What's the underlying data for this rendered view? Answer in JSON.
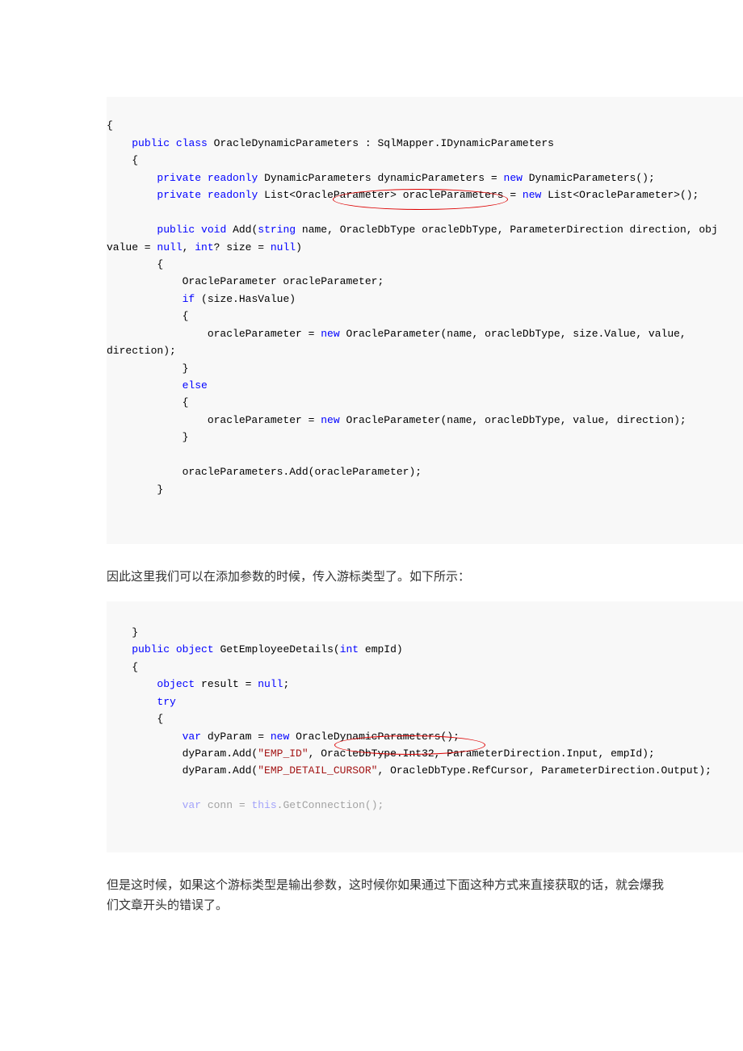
{
  "codeBlock1": {
    "line1": "{",
    "line2_indent": "    ",
    "line2_kw1": "public",
    "line2_sp1": " ",
    "line2_kw2": "class",
    "line2_txt": " OracleDynamicParameters : SqlMapper.IDynamicParameters",
    "line3": "    {",
    "line4_indent": "        ",
    "line4_kw1": "private",
    "line4_sp1": " ",
    "line4_kw2": "readonly",
    "line4_mid": " DynamicParameters dynamicParameters = ",
    "line4_kw3": "new",
    "line4_end": " DynamicParameters();",
    "line5_indent": "        ",
    "line5_kw1": "private",
    "line5_sp1": " ",
    "line5_kw2": "readonly",
    "line5_mid": " List<OracleParameter> oracleParameters = ",
    "line5_kw3": "new",
    "line5_end": " List<OracleParameter>();",
    "line7_indent": "        ",
    "line7_kw1": "public",
    "line7_sp1": " ",
    "line7_kw2": "void",
    "line7_mid": " Add(",
    "line7_kw3": "string",
    "line7_end": " name, OracleDbType oracleDbType, ParameterDirection direction, obj",
    "line8_pre": "value = ",
    "line8_kw1": "null",
    "line8_mid": ", ",
    "line8_kw2": "int",
    "line8_mid2": "? size = ",
    "line8_kw3": "null",
    "line8_end": ")",
    "line9": "        {",
    "line10": "            OracleParameter oracleParameter;",
    "line11_indent": "            ",
    "line11_kw": "if",
    "line11_end": " (size.HasValue)",
    "line12": "            {",
    "line13_indent": "                oracleParameter = ",
    "line13_kw": "new",
    "line13_end": " OracleParameter(name, oracleDbType, size.Value, value, ",
    "line14": "direction);",
    "line15": "            }",
    "line16_indent": "            ",
    "line16_kw": "else",
    "line17": "            {",
    "line18_indent": "                oracleParameter = ",
    "line18_kw": "new",
    "line18_end": " OracleParameter(name, oracleDbType, value, direction);",
    "line19": "            }",
    "line21": "            oracleParameters.Add(oracleParameter);",
    "line22": "        }"
  },
  "paragraph1": "因此这里我们可以在添加参数的时候，传入游标类型了。如下所示：",
  "codeBlock2": {
    "line1": "    }",
    "line2_indent": "    ",
    "line2_kw1": "public",
    "line2_sp1": " ",
    "line2_kw2": "object",
    "line2_mid": " GetEmployeeDetails(",
    "line2_kw3": "int",
    "line2_end": " empId)",
    "line3": "    {",
    "line4_indent": "        ",
    "line4_kw1": "object",
    "line4_mid": " result = ",
    "line4_kw2": "null",
    "line4_end": ";",
    "line5_indent": "        ",
    "line5_kw": "try",
    "line6": "        {",
    "line7_indent": "            ",
    "line7_kw1": "var",
    "line7_mid": " dyParam = ",
    "line7_kw2": "new",
    "line7_end": " OracleDynamicParameters();",
    "line8_indent": "            dyParam.Add(",
    "line8_str": "\"EMP_ID\"",
    "line8_end": ", OracleDbType.Int32, ParameterDirection.Input, empId);",
    "line9_indent": "            dyParam.Add(",
    "line9_str": "\"EMP_DETAIL_CURSOR\"",
    "line9_end": ", OracleDbType.RefCursor, ParameterDirection.Output);",
    "line11_indent": "            ",
    "line11_kw1": "var",
    "line11_mid": " conn = ",
    "line11_kw2": "this",
    "line11_end": ".GetConnection();"
  },
  "paragraph2": "但是这时候，如果这个游标类型是输出参数，这时候你如果通过下面这种方式来直接获取的话，就会爆我们文章开头的错误了。"
}
